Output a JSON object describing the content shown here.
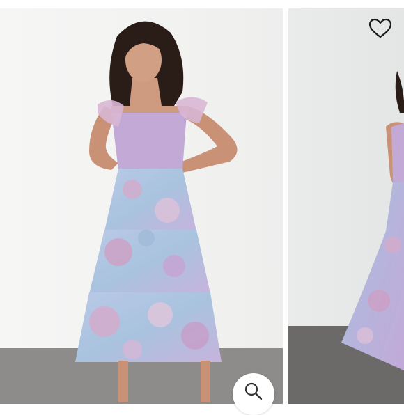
{
  "gallery": {
    "slides": [
      {
        "id": "slide-1"
      },
      {
        "id": "slide-2"
      }
    ],
    "favorite": {
      "icon": "heart-icon",
      "label": "Add to wishlist"
    },
    "zoom": {
      "icon": "magnifier-icon",
      "label": "Zoom image"
    }
  },
  "colors": {
    "dress_blue": "#a7c3df",
    "dress_pink": "#d7a9c9",
    "dress_lilac": "#b9a6d8",
    "hair": "#2a1d18",
    "skin": "#c99277",
    "floor": "#8d8c8a",
    "wall": "#f2f2f1"
  }
}
